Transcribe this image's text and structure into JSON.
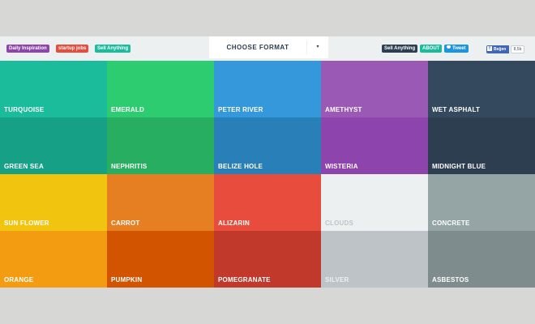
{
  "header": {
    "left_tags": [
      {
        "label": "Daily Inspiration",
        "color": "#8e44ad"
      },
      {
        "label": "startup jobs",
        "color": "#e74c3c"
      },
      {
        "label": "Sell Anything",
        "color": "#1abc9c"
      }
    ],
    "format_dropdown": {
      "label": "CHOOSE FORMAT",
      "caret": "▾"
    },
    "right_tags": [
      {
        "label": "Sell Anything",
        "color": "#2c3e50"
      },
      {
        "label": "ABOUT",
        "color": "#1abc9c"
      }
    ],
    "tweet_button": {
      "label": "Tweet",
      "color": "#1b95e0"
    },
    "fb_like": {
      "label": "Beğen",
      "count": "8,5b",
      "icon": "facebook-icon"
    }
  },
  "colors": [
    {
      "name": "TURQUOISE",
      "hex": "#1abc9c",
      "text_color": "#ffffff"
    },
    {
      "name": "EMERALD",
      "hex": "#2ecc71",
      "text_color": "#ffffff"
    },
    {
      "name": "PETER RIVER",
      "hex": "#3498db",
      "text_color": "#ffffff"
    },
    {
      "name": "AMETHYST",
      "hex": "#9b59b6",
      "text_color": "#ffffff"
    },
    {
      "name": "WET ASPHALT",
      "hex": "#34495e",
      "text_color": "#ffffff"
    },
    {
      "name": "GREEN SEA",
      "hex": "#16a085",
      "text_color": "#ffffff"
    },
    {
      "name": "NEPHRITIS",
      "hex": "#27ae60",
      "text_color": "#ffffff"
    },
    {
      "name": "BELIZE HOLE",
      "hex": "#2980b9",
      "text_color": "#ffffff"
    },
    {
      "name": "WISTERIA",
      "hex": "#8e44ad",
      "text_color": "#ffffff"
    },
    {
      "name": "MIDNIGHT BLUE",
      "hex": "#2c3e50",
      "text_color": "#ffffff"
    },
    {
      "name": "SUN FLOWER",
      "hex": "#f1c40f",
      "text_color": "#ffffff"
    },
    {
      "name": "CARROT",
      "hex": "#e67e22",
      "text_color": "#ffffff"
    },
    {
      "name": "ALIZARIN",
      "hex": "#e74c3c",
      "text_color": "#ffffff"
    },
    {
      "name": "CLOUDS",
      "hex": "#ecf0f1",
      "text_color": "#bdc3c7"
    },
    {
      "name": "CONCRETE",
      "hex": "#95a5a6",
      "text_color": "#ffffff"
    },
    {
      "name": "ORANGE",
      "hex": "#f39c12",
      "text_color": "#ffffff"
    },
    {
      "name": "PUMPKIN",
      "hex": "#d35400",
      "text_color": "#ffffff"
    },
    {
      "name": "POMEGRANATE",
      "hex": "#c0392b",
      "text_color": "#ffffff"
    },
    {
      "name": "SILVER",
      "hex": "#bdc3c7",
      "text_color": "#ecf0f1"
    },
    {
      "name": "ASBESTOS",
      "hex": "#7f8c8d",
      "text_color": "#ffffff"
    }
  ]
}
